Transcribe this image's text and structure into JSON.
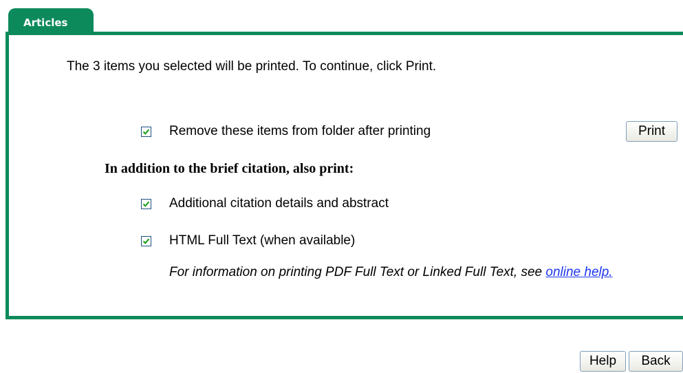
{
  "tab": {
    "label": "Articles"
  },
  "message": "The 3 items you selected will be printed. To continue, click Print.",
  "options": {
    "remove_items": {
      "label": "Remove these items from folder after printing",
      "checked": true
    },
    "heading": "In addition to the brief citation, also print:",
    "citation_details": {
      "label": "Additional citation details and abstract",
      "checked": true
    },
    "html_full_text": {
      "label": "HTML Full Text (when available)",
      "checked": true
    }
  },
  "note": {
    "text": "For information on printing PDF Full Text or Linked Full Text, see ",
    "link_text": "online help."
  },
  "buttons": {
    "print": "Print",
    "help": "Help",
    "back": "Back"
  },
  "colors": {
    "accent": "#0c8a5c",
    "link": "#1d35ee",
    "checkmark": "#21a121"
  }
}
